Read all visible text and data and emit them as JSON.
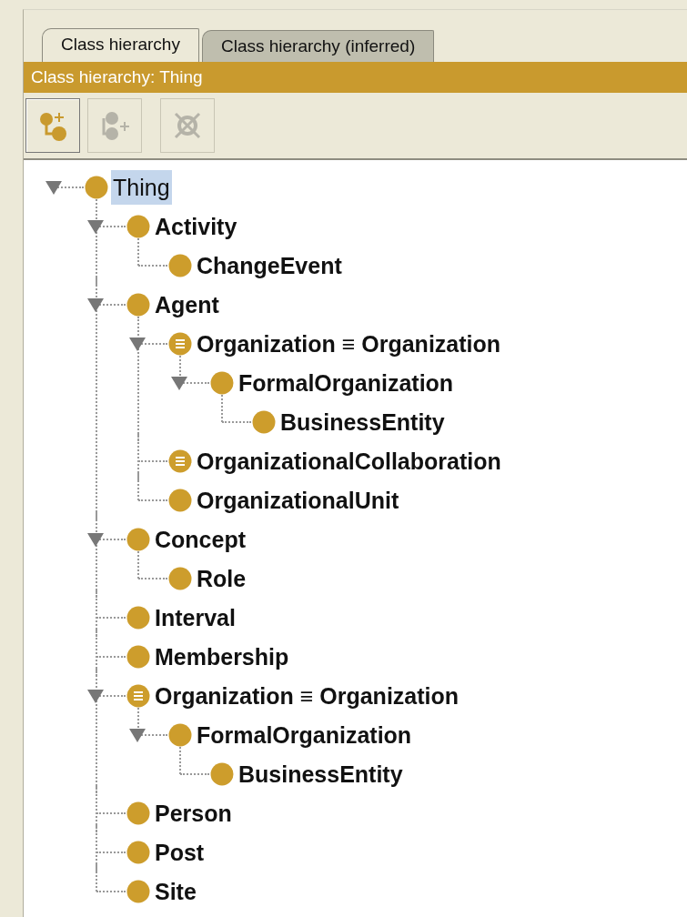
{
  "tabs": [
    {
      "label": "Class hierarchy",
      "selected": true
    },
    {
      "label": "Class hierarchy (inferred)",
      "selected": false
    }
  ],
  "header": {
    "title": "Class hierarchy: Thing"
  },
  "toolbar": [
    {
      "kind": "add-subclass",
      "disabled": false
    },
    {
      "kind": "add-sibling",
      "disabled": true
    },
    {
      "kind": "delete",
      "disabled": true
    }
  ],
  "tree": [
    {
      "label": "Thing",
      "kind": "class",
      "selected": true,
      "expanded": true,
      "children": [
        {
          "label": "Activity",
          "kind": "class",
          "selected": false,
          "expanded": true,
          "children": [
            {
              "label": "ChangeEvent",
              "kind": "class",
              "selected": false
            }
          ]
        },
        {
          "label": "Agent",
          "kind": "class",
          "selected": false,
          "expanded": true,
          "children": [
            {
              "label": "Organization ≡ Organization",
              "kind": "defined",
              "selected": false,
              "expanded": true,
              "children": [
                {
                  "label": "FormalOrganization",
                  "kind": "class",
                  "selected": false,
                  "expanded": true,
                  "children": [
                    {
                      "label": "BusinessEntity",
                      "kind": "class",
                      "selected": false
                    }
                  ]
                }
              ]
            },
            {
              "label": "OrganizationalCollaboration",
              "kind": "defined",
              "selected": false
            },
            {
              "label": "OrganizationalUnit",
              "kind": "class",
              "selected": false
            }
          ]
        },
        {
          "label": "Concept",
          "kind": "class",
          "selected": false,
          "expanded": true,
          "children": [
            {
              "label": "Role",
              "kind": "class",
              "selected": false
            }
          ]
        },
        {
          "label": "Interval",
          "kind": "class",
          "selected": false
        },
        {
          "label": "Membership",
          "kind": "class",
          "selected": false
        },
        {
          "label": "Organization ≡ Organization",
          "kind": "defined",
          "selected": false,
          "expanded": true,
          "children": [
            {
              "label": "FormalOrganization",
              "kind": "class",
              "selected": false,
              "expanded": true,
              "children": [
                {
                  "label": "BusinessEntity",
                  "kind": "class",
                  "selected": false
                }
              ]
            }
          ]
        },
        {
          "label": "Person",
          "kind": "class",
          "selected": false
        },
        {
          "label": "Post",
          "kind": "class",
          "selected": false
        },
        {
          "label": "Site",
          "kind": "class",
          "selected": false
        }
      ]
    }
  ]
}
